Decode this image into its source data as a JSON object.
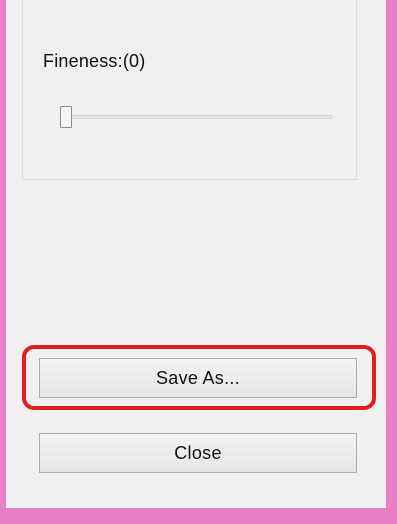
{
  "panel": {
    "fineness_label": "Fineness:(0)",
    "fineness_value": 0
  },
  "buttons": {
    "save_as_label": "Save As...",
    "close_label": "Close"
  },
  "colors": {
    "window_border": "#e87ec6",
    "panel_background": "#f0f0f0",
    "highlight": "#e21e1e"
  }
}
